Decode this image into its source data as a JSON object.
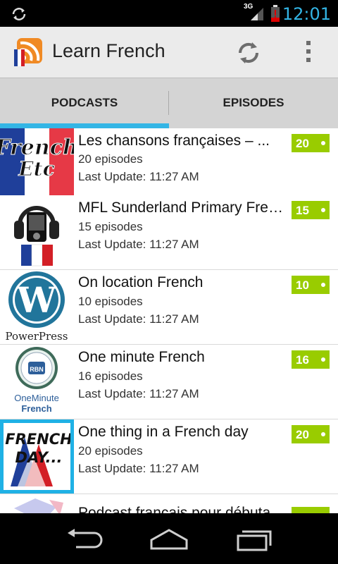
{
  "status_bar": {
    "network_type": "3G",
    "time": "12:01",
    "accent_color": "#33b5e5"
  },
  "action_bar": {
    "title": "Learn French",
    "icons": [
      "podcast-logo-icon",
      "refresh-icon",
      "overflow-menu-icon"
    ]
  },
  "tabs": [
    {
      "label": "PODCASTS",
      "selected": true
    },
    {
      "label": "EPISODES",
      "selected": false
    }
  ],
  "podcasts": [
    {
      "title": "Les chansons françaises – ...",
      "episodes": "20 episodes",
      "last_update": "Last Update: 11:27 AM",
      "badge": "20",
      "art_text": [
        "French",
        "Etc"
      ]
    },
    {
      "title": "MFL Sunderland Primary French...",
      "episodes": "15 episodes",
      "last_update": "Last Update: 11:27 AM",
      "badge": "15"
    },
    {
      "title": "On location French",
      "episodes": "10 episodes",
      "last_update": "Last Update: 11:27 AM",
      "badge": "10",
      "art_text": [
        "PowerPress"
      ]
    },
    {
      "title": "One minute French",
      "episodes": "16 episodes",
      "last_update": "Last Update: 11:27 AM",
      "badge": "16",
      "art_text": [
        "OneMinute",
        "French"
      ]
    },
    {
      "title": "One thing in a French day",
      "episodes": "20 episodes",
      "last_update": "Last Update: 11:27 AM",
      "badge": "20",
      "art_text": [
        "FRENCH",
        "DAY..."
      ]
    },
    {
      "title": "Podcast français pour débutants"
    }
  ],
  "colors": {
    "badge": "#99cc00",
    "selection": "#1fb1e5",
    "tab_bg": "#d4d4d4",
    "action_bar_bg": "#ebebeb"
  }
}
